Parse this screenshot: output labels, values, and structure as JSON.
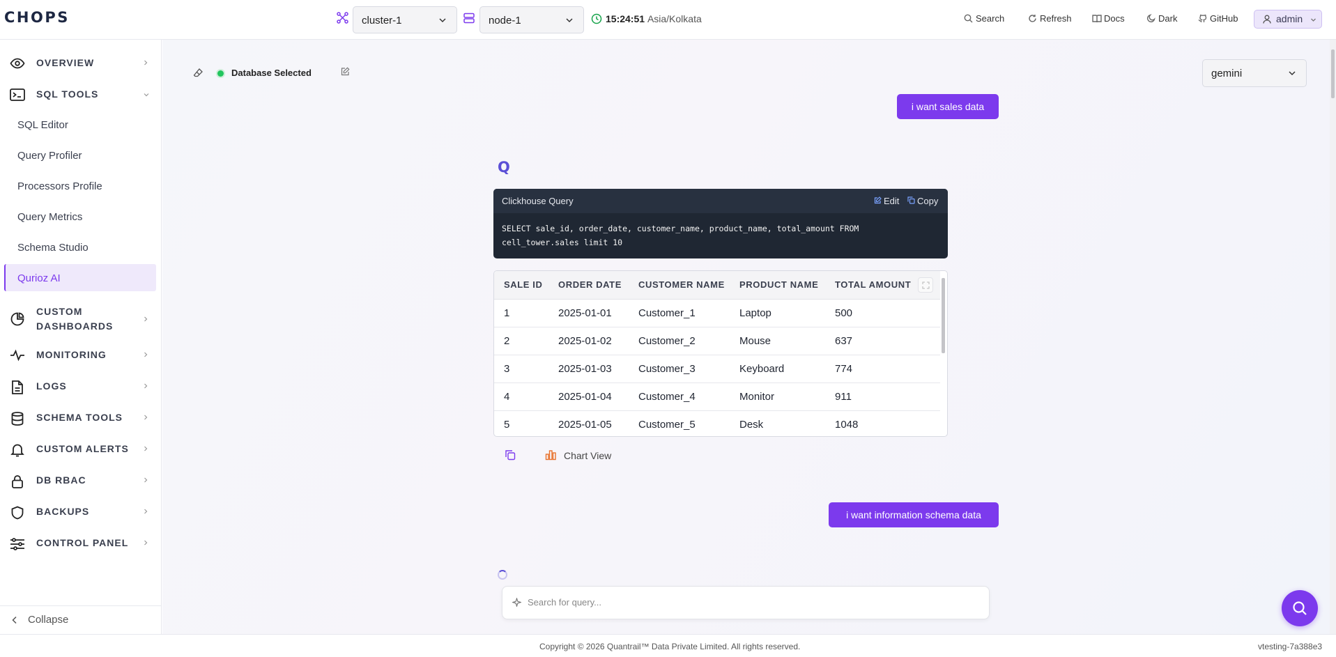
{
  "app": {
    "logo": "CHOPS"
  },
  "header": {
    "cluster": "cluster-1",
    "node": "node-1",
    "time": "15:24:51",
    "timezone": "Asia/Kolkata",
    "search": "Search",
    "refresh": "Refresh",
    "docs": "Docs",
    "theme": "Dark",
    "github": "GitHub",
    "user": "admin"
  },
  "sidebar": {
    "overview": "OVERVIEW",
    "sql_tools": "SQL TOOLS",
    "sql_items": [
      "SQL Editor",
      "Query Profiler",
      "Processors Profile",
      "Query Metrics",
      "Schema Studio",
      "Qurioz AI"
    ],
    "custom_dashboards": [
      "CUSTOM",
      "DASHBOARDS"
    ],
    "monitoring": "MONITORING",
    "logs": "LOGS",
    "schema_tools": "SCHEMA TOOLS",
    "custom_alerts": "CUSTOM ALERTS",
    "db_rbac": "DB RBAC",
    "backups": "BACKUPS",
    "control_panel": "CONTROL PANEL",
    "collapse": "Collapse"
  },
  "chat": {
    "db_status": "Database Selected",
    "model": "gemini",
    "msg1": "i want sales data",
    "avatar_letter": "Q",
    "query_title": "Clickhouse Query",
    "edit": "Edit",
    "copy": "Copy",
    "query_line1": "SELECT sale_id, order_date, customer_name, product_name, total_amount FROM",
    "query_line2": "cell_tower.sales limit 10",
    "columns": [
      "SALE ID",
      "ORDER DATE",
      "CUSTOMER NAME",
      "PRODUCT NAME",
      "TOTAL AMOUNT"
    ],
    "rows": [
      [
        "1",
        "2025-01-01",
        "Customer_1",
        "Laptop",
        "500"
      ],
      [
        "2",
        "2025-01-02",
        "Customer_2",
        "Mouse",
        "637"
      ],
      [
        "3",
        "2025-01-03",
        "Customer_3",
        "Keyboard",
        "774"
      ],
      [
        "4",
        "2025-01-04",
        "Customer_4",
        "Monitor",
        "911"
      ],
      [
        "5",
        "2025-01-05",
        "Customer_5",
        "Desk",
        "1048"
      ]
    ],
    "chart_view": "Chart View",
    "msg2": "i want information schema data",
    "search_placeholder": "Search for query..."
  },
  "footer": {
    "copyright": "Copyright © 2026 Quantrail™ Data Private Limited. All rights reserved.",
    "version": "vtesting-7a388e3"
  },
  "colors": {
    "accent": "#7c3aed",
    "status_ok": "#22c55e",
    "code_bg": "#1f2733"
  }
}
